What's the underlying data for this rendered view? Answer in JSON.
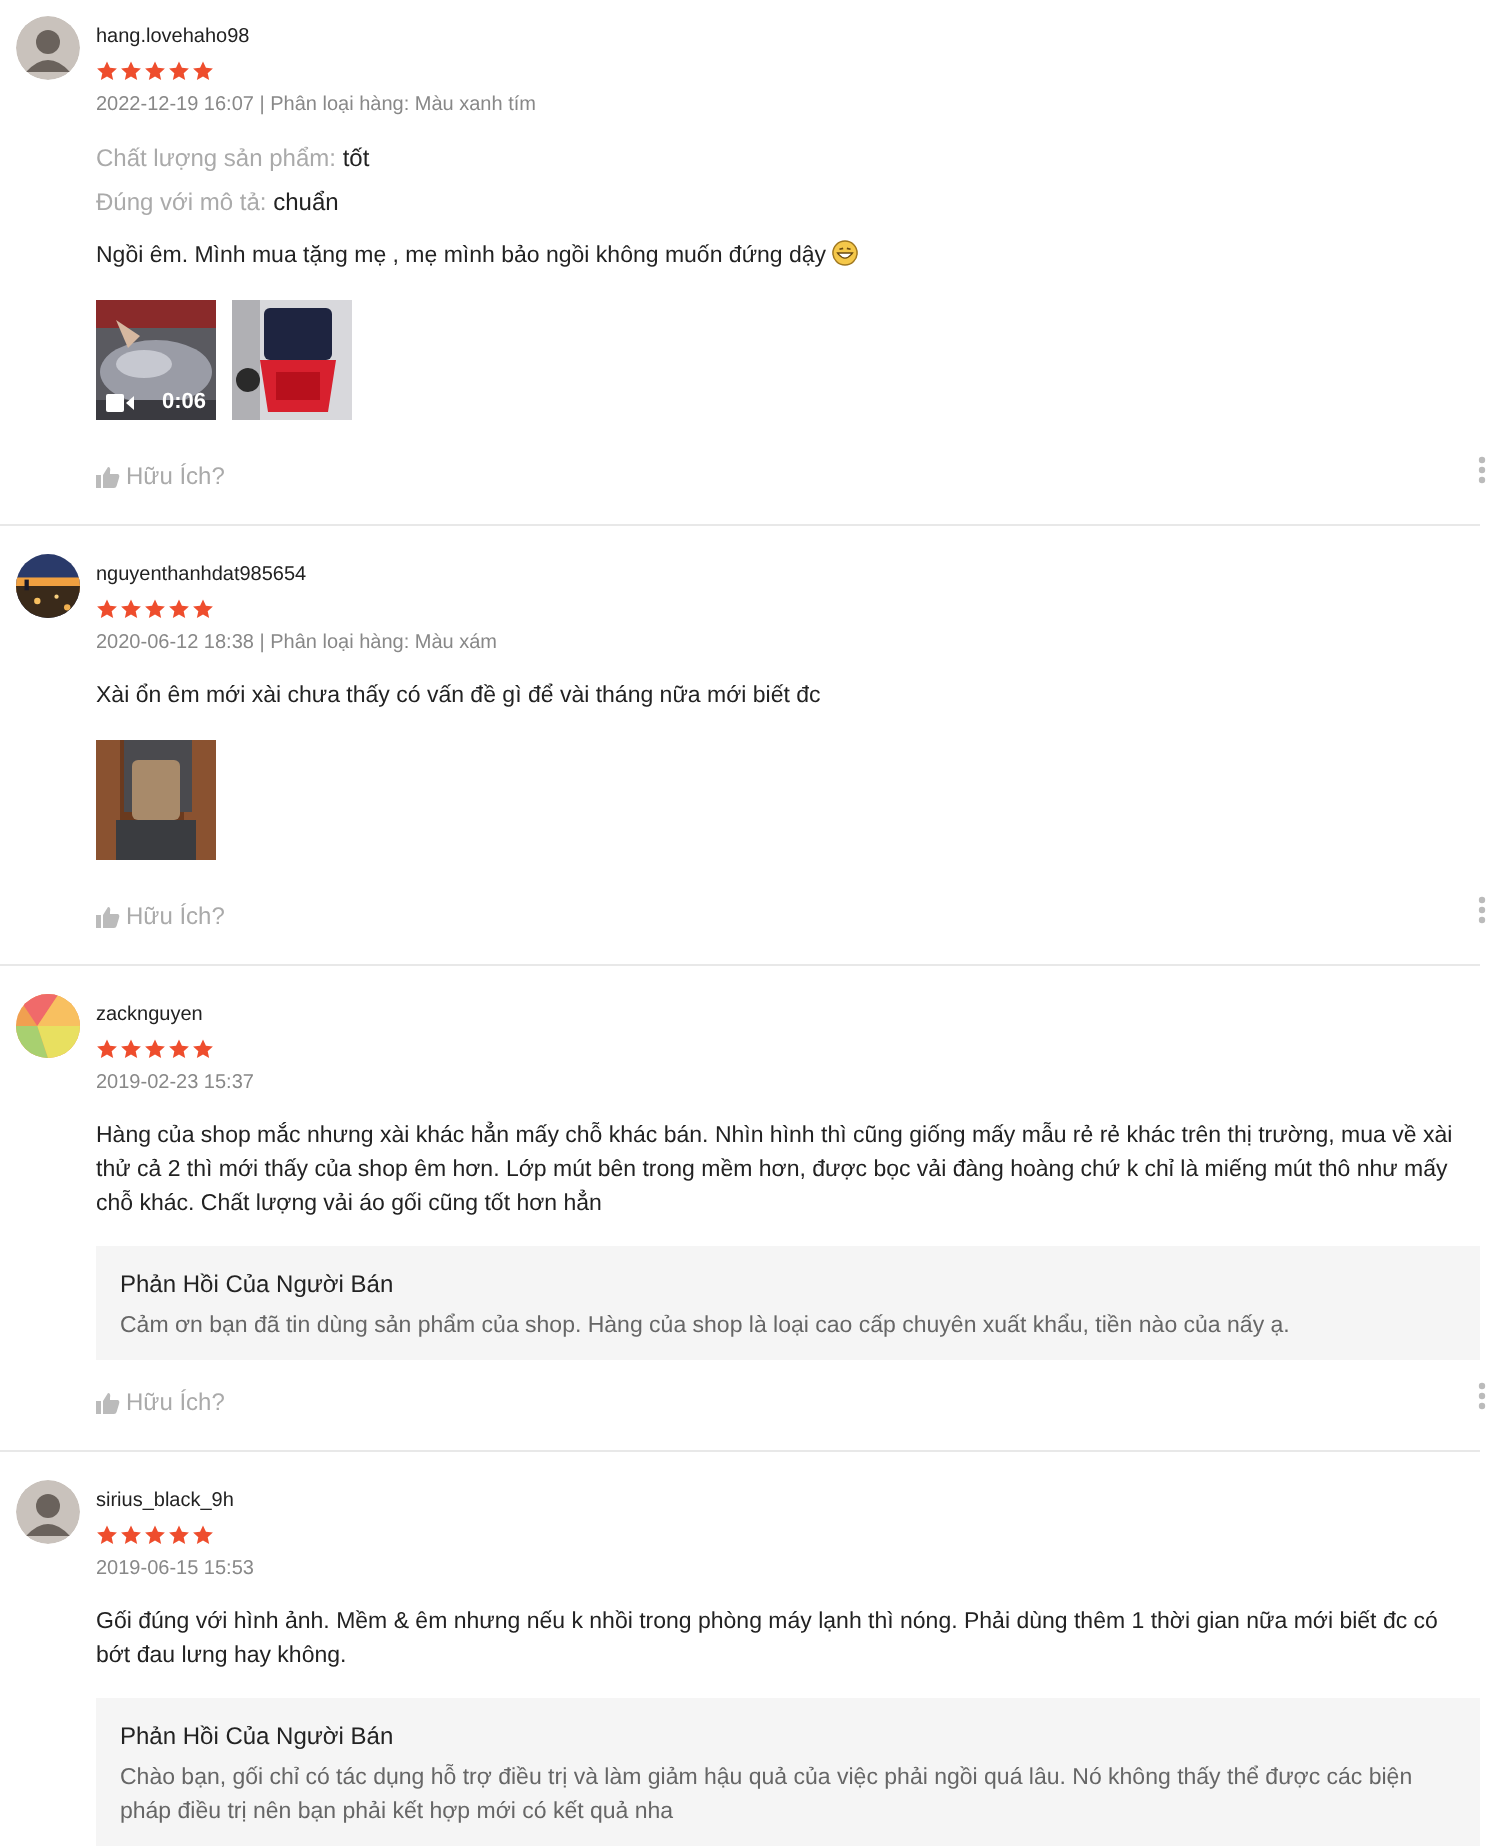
{
  "reviews": [
    {
      "username": "hang.lovehaho98",
      "avatar": {
        "kind": "silhouette"
      },
      "stars": 5,
      "meta": "2022-12-19 16:07 | Phân loại hàng: Màu xanh tím",
      "attributes": [
        {
          "label": "Chất lượng sản phẩm:",
          "value": "tốt"
        },
        {
          "label": "Đúng với mô tả:",
          "value": "chuẩn"
        }
      ],
      "text": "Ngồi êm. Mình mua tặng mẹ , mẹ mình bảo ngồi không muốn đứng dậy",
      "emoji": true,
      "media": [
        {
          "kind": "video",
          "duration": "0:06"
        },
        {
          "kind": "picture"
        }
      ],
      "helpful": "Hữu Ích?"
    },
    {
      "username": "nguyenthanhdat985654",
      "avatar": {
        "kind": "picture"
      },
      "stars": 5,
      "meta": "2020-06-12 18:38 | Phân loại hàng: Màu xám",
      "text": "Xài ổn êm mới xài chưa thấy có vấn đề gì để vài tháng nữa mới biết đc",
      "media": [
        {
          "kind": "picture"
        }
      ],
      "helpful": "Hữu Ích?"
    },
    {
      "username": "zacknguyen",
      "avatar": {
        "kind": "picture"
      },
      "stars": 5,
      "meta": "2019-02-23 15:37",
      "text": "Hàng của shop mắc nhưng xài khác hẳn mấy chỗ khác bán. Nhìn hình thì cũng giống mấy mẫu rẻ rẻ khác trên thị trường, mua về xài thử cả 2 thì mới thấy của shop êm hơn. Lớp mút bên trong mềm hơn, được bọc vải đàng hoàng chứ k chỉ là miếng mút thô như mấy chỗ khác. Chất lượng vải áo gối cũng tốt hơn hẳn",
      "reply": {
        "title": "Phản Hồi Của Người Bán",
        "text": "Cảm ơn bạn đã tin dùng sản phẩm của shop. Hàng của shop là loại cao cấp chuyên xuất khẩu, tiền nào của nấy ạ."
      },
      "helpful": "Hữu Ích?"
    },
    {
      "username": "sirius_black_9h",
      "avatar": {
        "kind": "silhouette"
      },
      "stars": 5,
      "meta": "2019-06-15 15:53",
      "text": "Gối đúng với hình ảnh. Mềm & êm nhưng nếu k nhồi trong phòng máy lạnh thì nóng. Phải dùng thêm 1 thời gian nữa mới biết đc có bớt đau lưng hay không.",
      "reply": {
        "title": "Phản Hồi Của Người Bán",
        "text": "Chào bạn, gối chỉ có tác dụng hỗ trợ điều trị và làm giảm hậu quả của việc phải ngồi quá lâu. Nó không thấy thể được các biện pháp điều trị nên bạn phải kết hợp mới có kết quả nha"
      }
    }
  ]
}
